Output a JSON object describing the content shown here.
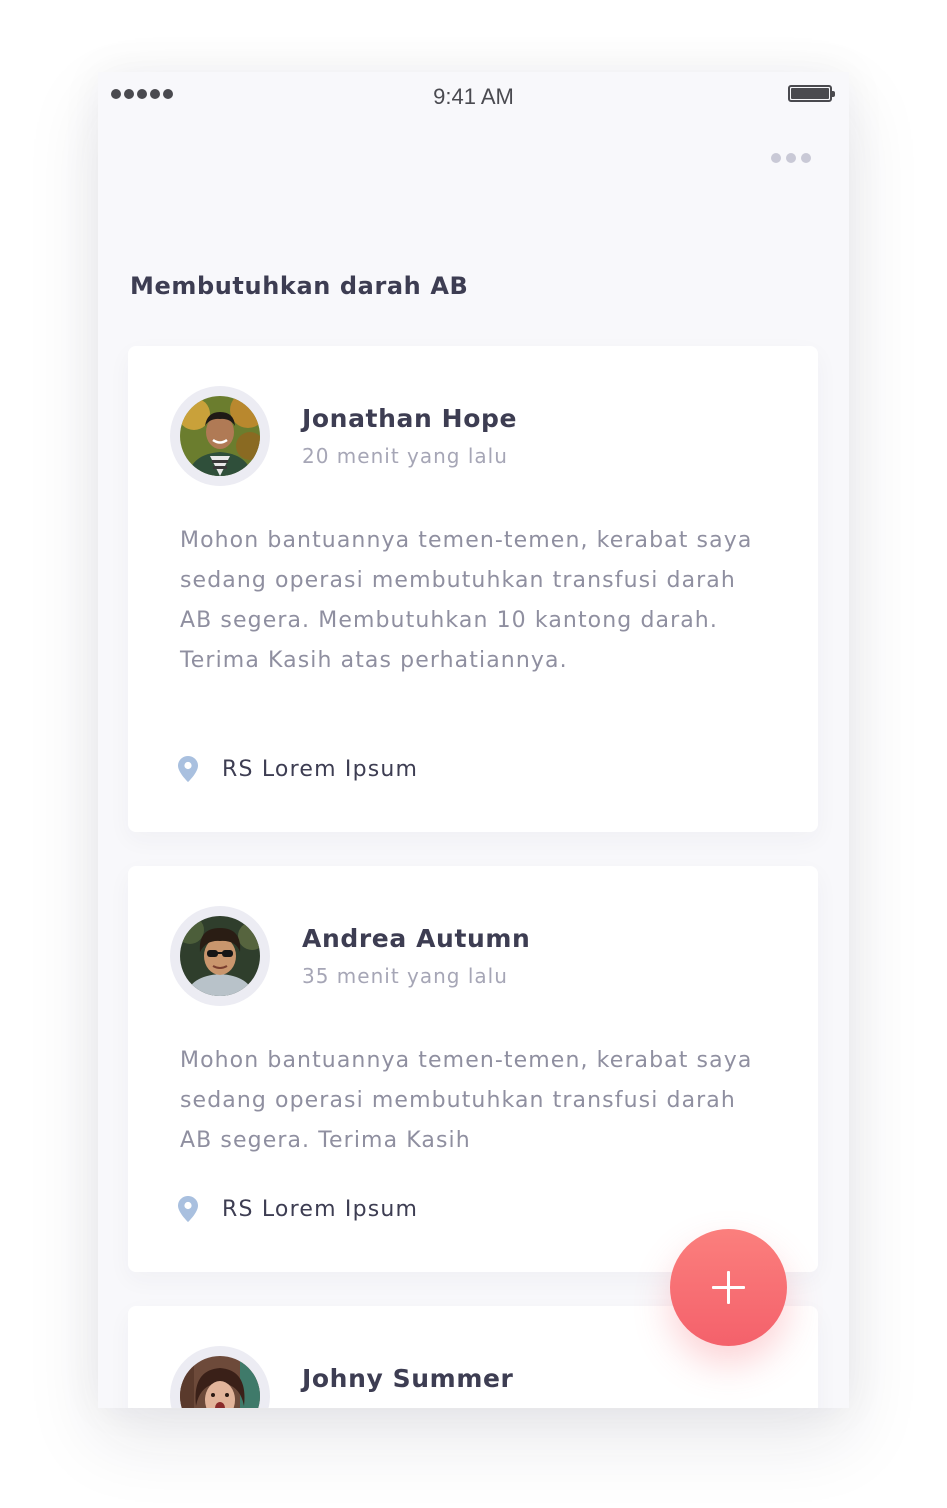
{
  "status_bar": {
    "time": "9:41 AM"
  },
  "page": {
    "title": "Membutuhkan darah AB",
    "more_icon": "more-horizontal-icon"
  },
  "requests": [
    {
      "name": "Jonathan Hope",
      "time_ago": "20 menit yang lalu",
      "message": "Mohon bantuannya temen-temen, kerabat saya sedang operasi membutuhkan transfusi darah AB segera. Membutuhkan 10 kantong darah. Terima Kasih atas perhatiannya.",
      "location": "RS Lorem Ipsum"
    },
    {
      "name": "Andrea Autumn",
      "time_ago": "35 menit yang lalu",
      "message": "Mohon bantuannya temen-temen, kerabat saya sedang operasi membutuhkan transfusi darah AB segera. Terima Kasih",
      "location": "RS Lorem Ipsum"
    },
    {
      "name": "Johny Summer"
    }
  ],
  "fab": {
    "icon": "plus-icon"
  },
  "colors": {
    "accent": "#f4616b",
    "heading": "#3d3d52",
    "muted": "#a6a6b6",
    "pin": "#a9c0df"
  }
}
